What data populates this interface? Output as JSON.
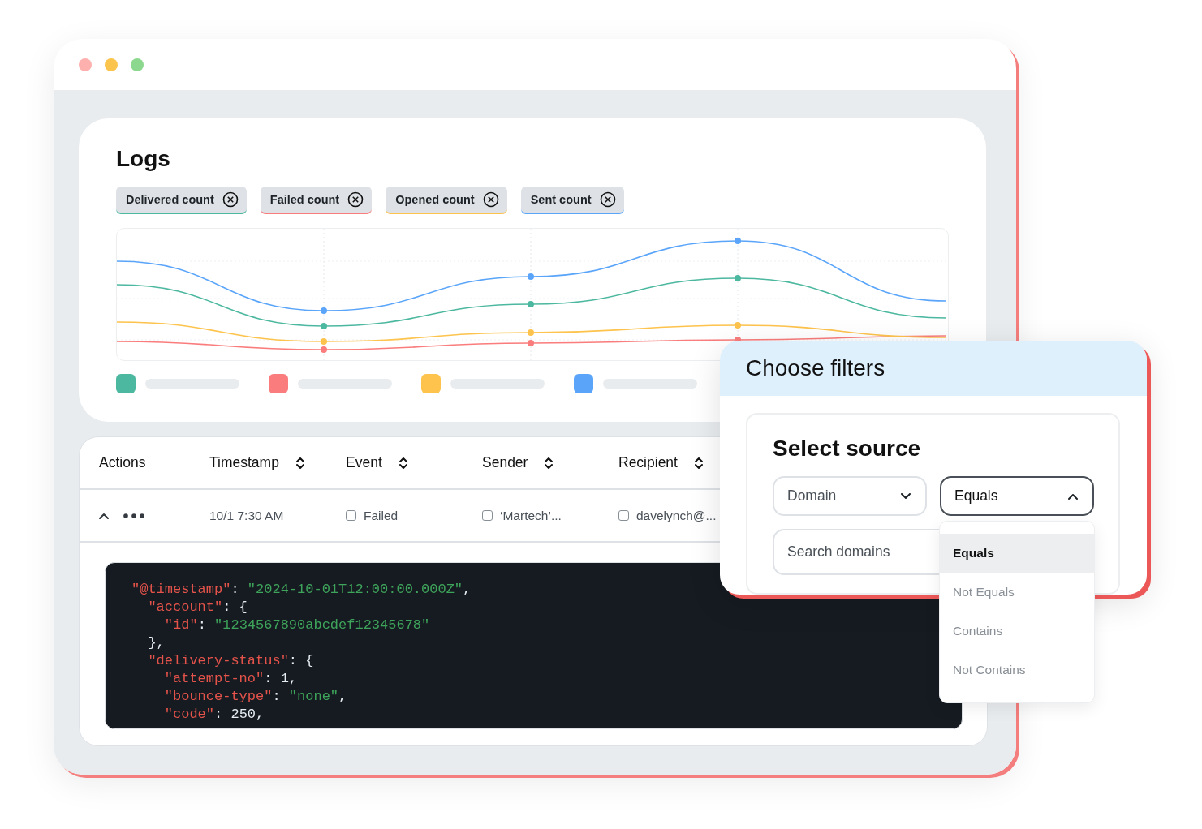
{
  "window": {
    "controls": [
      {
        "color": "#fdb0ae"
      },
      {
        "color": "#fbc54d"
      },
      {
        "color": "#8dd88f"
      }
    ]
  },
  "logs": {
    "title": "Logs",
    "chips": [
      {
        "label": "Delivered count",
        "color": "#4db8a0"
      },
      {
        "label": "Failed count",
        "color": "#fa7c7c"
      },
      {
        "label": "Opened count",
        "color": "#fdc34c"
      },
      {
        "label": "Sent count",
        "color": "#5aa5fa"
      }
    ],
    "legend": [
      {
        "color": "#4db8a0"
      },
      {
        "color": "#fa7c7c"
      },
      {
        "color": "#fdc34c"
      },
      {
        "color": "#5aa5fa"
      }
    ]
  },
  "table": {
    "columns": [
      {
        "label": "Actions",
        "sortable": false
      },
      {
        "label": "Timestamp",
        "sortable": true
      },
      {
        "label": "Event",
        "sortable": true
      },
      {
        "label": "Sender",
        "sortable": true
      },
      {
        "label": "Recipient",
        "sortable": true
      }
    ],
    "rows": [
      {
        "expanded": true,
        "cells": [
          {
            "kind": "actions"
          },
          {
            "kind": "text",
            "text": "10/1 7:30 AM"
          },
          {
            "kind": "checkbox",
            "text": "Failed",
            "checked": false
          },
          {
            "kind": "checkbox",
            "text": "‘Martech’...",
            "checked": false
          },
          {
            "kind": "checkbox",
            "text": "davelynch@...",
            "checked": false
          }
        ],
        "code": [
          [
            {
              "kind": "key",
              "text": "\"@timestamp\""
            },
            {
              "kind": "punct",
              "text": ": "
            },
            {
              "kind": "string",
              "text": "\"2024-10-01T12:00:00.000Z\""
            },
            {
              "kind": "punct",
              "text": ","
            }
          ],
          [
            {
              "kind": "key",
              "text": "  \"account\""
            },
            {
              "kind": "punct",
              "text": ": {"
            }
          ],
          [
            {
              "kind": "key",
              "text": "    \"id\""
            },
            {
              "kind": "punct",
              "text": ": "
            },
            {
              "kind": "string",
              "text": "\"1234567890abcdef12345678\""
            }
          ],
          [
            {
              "kind": "punct",
              "text": "  },"
            }
          ],
          [
            {
              "kind": "key",
              "text": "  \"delivery-status\""
            },
            {
              "kind": "punct",
              "text": ": {"
            }
          ],
          [
            {
              "kind": "key",
              "text": "    \"attempt-no\""
            },
            {
              "kind": "punct",
              "text": ": 1,"
            }
          ],
          [
            {
              "kind": "key",
              "text": "    \"bounce-type\""
            },
            {
              "kind": "punct",
              "text": ": "
            },
            {
              "kind": "string",
              "text": "\"none\""
            },
            {
              "kind": "punct",
              "text": ","
            }
          ],
          [
            {
              "kind": "key",
              "text": "    \"code\""
            },
            {
              "kind": "punct",
              "text": ": 250,"
            }
          ]
        ]
      }
    ]
  },
  "filters": {
    "title": "Choose filters",
    "section_title": "Select source",
    "source": {
      "value": "Domain",
      "expanded": false
    },
    "operator": {
      "value": "Equals",
      "expanded": true,
      "options": [
        {
          "label": "Equals",
          "selected": true
        },
        {
          "label": "Not Equals",
          "selected": false
        },
        {
          "label": "Contains",
          "selected": false
        },
        {
          "label": "Not Contains",
          "selected": false
        }
      ]
    },
    "search": {
      "placeholder": "Search domains"
    }
  }
}
